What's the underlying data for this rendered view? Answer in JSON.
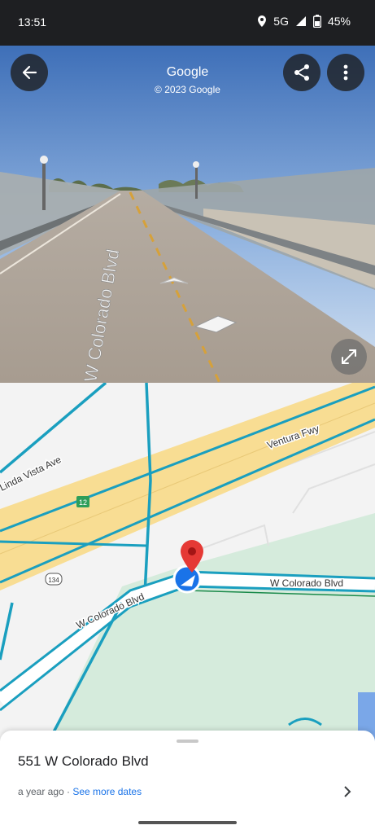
{
  "status_bar": {
    "time": "13:51",
    "network": "5G",
    "battery": "45%"
  },
  "street_view": {
    "title": "Google",
    "copyright": "© 2023 Google",
    "road_label": "W Colorado Blvd"
  },
  "map": {
    "labels": {
      "linda_vista": "Linda Vista Ave",
      "ventura": "Ventura Fwy",
      "colorado_right": "W Colorado Blvd",
      "colorado_left": "W Colorado Blvd",
      "route_12": "12",
      "route_134": "134"
    }
  },
  "sheet": {
    "address": "551 W Colorado Blvd",
    "date_text": "a year ago · ",
    "see_more": "See more dates"
  },
  "colors": {
    "accent": "#1a73e8",
    "road": "#1a9fbf",
    "freeway": "#f8dd93",
    "park": "#d5ebdc",
    "pin": "#e53935"
  }
}
